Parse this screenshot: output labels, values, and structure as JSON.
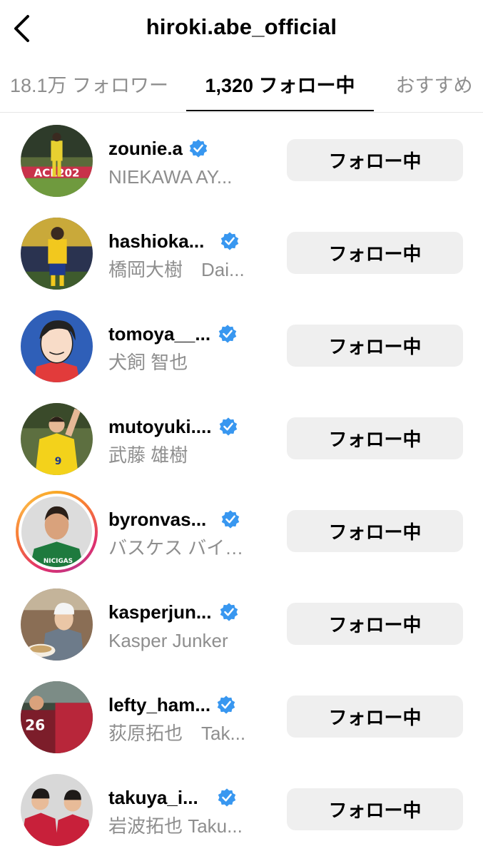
{
  "header": {
    "back_icon": "chevron-left-icon",
    "title": "hiroki.abe_official"
  },
  "tabs": [
    {
      "label": "18.1万 フォロワー",
      "active": false
    },
    {
      "label": "1,320 フォロー中",
      "active": true
    },
    {
      "label": "おすすめ",
      "active": false
    }
  ],
  "following": [
    {
      "username": "zounie.a",
      "full_name": "NIEKAWA AY...",
      "verified": true,
      "story_ring": false,
      "button": "フォロー中"
    },
    {
      "username": "hashioka...",
      "full_name": "橋岡大樹　Dai...",
      "verified": true,
      "story_ring": false,
      "button": "フォロー中"
    },
    {
      "username": "tomoya__...",
      "full_name": "犬飼 智也",
      "verified": true,
      "story_ring": false,
      "button": "フォロー中"
    },
    {
      "username": "mutoyuki....",
      "full_name": "武藤 雄樹",
      "verified": true,
      "story_ring": false,
      "button": "フォロー中"
    },
    {
      "username": "byronvas...",
      "full_name": "バスケス バイ…",
      "verified": true,
      "story_ring": true,
      "button": "フォロー中"
    },
    {
      "username": "kasperjun...",
      "full_name": "Kasper Junker",
      "verified": true,
      "story_ring": false,
      "button": "フォロー中"
    },
    {
      "username": "lefty_ham...",
      "full_name": "荻原拓也　Tak...",
      "verified": true,
      "story_ring": false,
      "button": "フォロー中"
    },
    {
      "username": "takuya_i...",
      "full_name": "岩波拓也 Taku...",
      "verified": true,
      "story_ring": false,
      "button": "フォロー中"
    }
  ],
  "colors": {
    "verified_blue": "#3897f0",
    "secondary_text": "#8e8e8e",
    "button_bg": "#efefef"
  }
}
